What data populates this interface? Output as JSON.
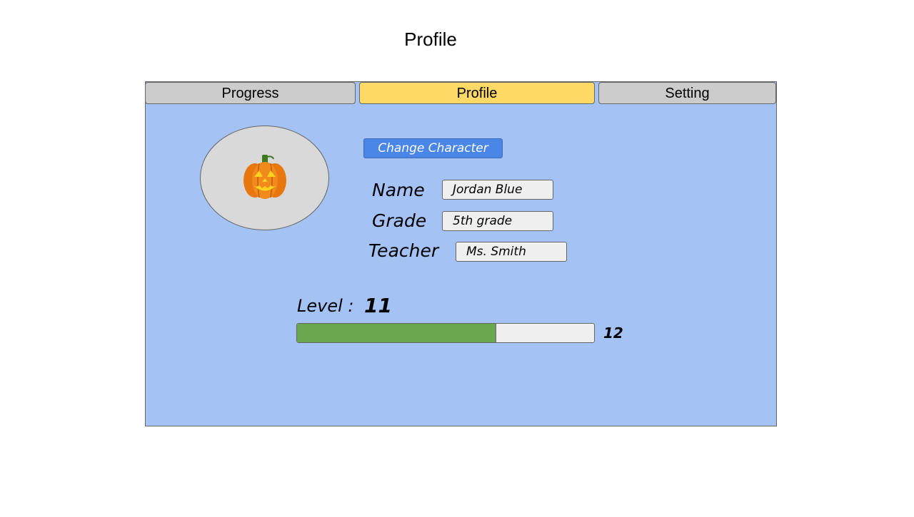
{
  "page": {
    "title": "Profile"
  },
  "tabs": {
    "progress": "Progress",
    "profile": "Profile",
    "setting": "Setting",
    "active": "Profile"
  },
  "avatar": {
    "icon": "jack-o-lantern-icon",
    "glyph": "🎃"
  },
  "change_character_label": "Change Character",
  "fields": {
    "name": {
      "label": "Name",
      "value": "Jordan Blue"
    },
    "grade": {
      "label": "Grade",
      "value": "5th grade"
    },
    "teacher": {
      "label": "Teacher",
      "value": "Ms. Smith"
    }
  },
  "level": {
    "label": "Level :",
    "current": "11",
    "next": "12",
    "progress_fraction": 0.67
  },
  "colors": {
    "panel_background": "#a4c2f4",
    "active_tab": "#ffd966",
    "inactive_tab": "#cccccc",
    "button": "#4a86e8",
    "progress_fill": "#6aa84f",
    "progress_track": "#efefef"
  }
}
